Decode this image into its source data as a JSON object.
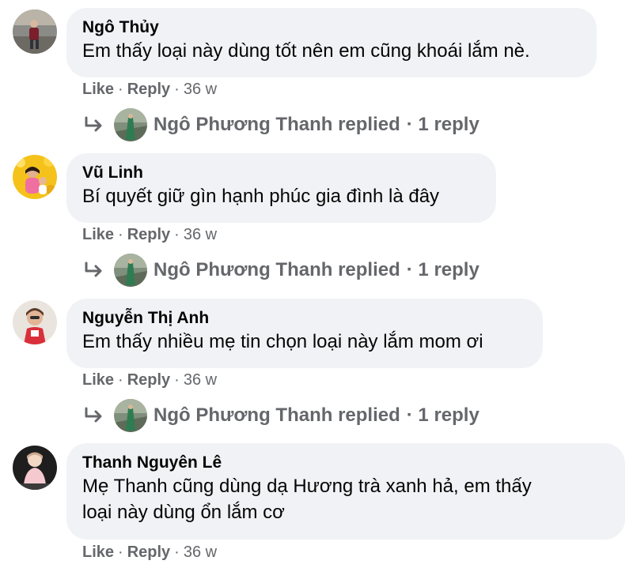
{
  "comments": [
    {
      "author": "Ngô Thủy",
      "text": "Em thấy loại này dùng tốt nên em cũng khoái lắm nè.",
      "like": "Like",
      "reply": "Reply",
      "time": "36 w",
      "replies": {
        "name": "Ngô Phương Thanh replied",
        "count": "· 1 reply"
      }
    },
    {
      "author": "Vũ Linh",
      "text": "Bí quyết giữ gìn hạnh phúc gia đình là đây",
      "like": "Like",
      "reply": "Reply",
      "time": "36 w",
      "replies": {
        "name": "Ngô Phương Thanh replied",
        "count": "· 1 reply"
      }
    },
    {
      "author": "Nguyễn Thị Anh",
      "text": "Em thấy nhiều mẹ tin chọn loại này lắm mom ơi",
      "like": "Like",
      "reply": "Reply",
      "time": "36 w",
      "replies": {
        "name": "Ngô Phương Thanh replied",
        "count": "· 1 reply"
      }
    },
    {
      "author": "Thanh Nguyên Lê",
      "text_line1": "Mẹ Thanh cũng dùng dạ Hương trà xanh hả, em thấy",
      "text_line2": "loại này dùng ổn lắm cơ",
      "like": "Like",
      "reply": "Reply",
      "time": "36 w"
    }
  ],
  "colors": {
    "bubble": "#f0f2f5",
    "secondary_text": "#65676b",
    "primary_text": "#050505"
  }
}
